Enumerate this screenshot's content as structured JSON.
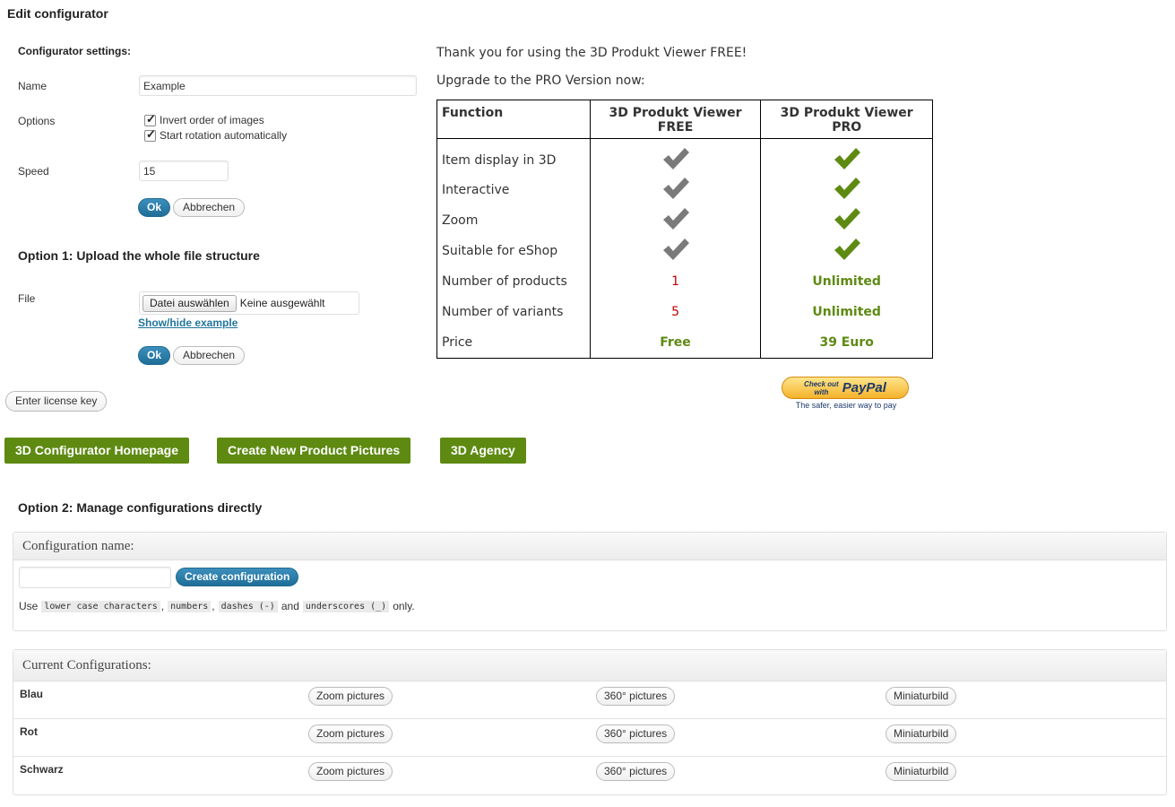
{
  "page_title": "Edit configurator",
  "settings": {
    "heading": "Configurator settings:",
    "name_label": "Name",
    "name_value": "Example",
    "options_label": "Options",
    "option_invert": "Invert order of images",
    "option_rotation": "Start rotation automatically",
    "speed_label": "Speed",
    "speed_value": "15",
    "ok_label": "Ok",
    "cancel_label": "Abbrechen"
  },
  "option1": {
    "heading": "Option 1: Upload the whole file structure",
    "file_label": "File",
    "choose_file_label": "Datei auswählen",
    "no_file_text": "Keine ausgewählt",
    "show_hide_link": "Show/hide example",
    "ok_label": "Ok",
    "cancel_label": "Abbrechen"
  },
  "license_button": "Enter license key",
  "promo": {
    "thank_you": "Thank you for using the 3D Produkt Viewer FREE!",
    "upgrade": "Upgrade to the PRO Version now:",
    "table": {
      "col_function": "Function",
      "col_free_line1": "3D Produkt Viewer",
      "col_free_line2": "FREE",
      "col_pro_line1": "3D Produkt Viewer",
      "col_pro_line2": "PRO",
      "rows": [
        {
          "label": "Item display in 3D",
          "free": "check",
          "pro": "check"
        },
        {
          "label": "Interactive",
          "free": "check",
          "pro": "check"
        },
        {
          "label": "Zoom",
          "free": "check",
          "pro": "check"
        },
        {
          "label": "Suitable for eShop",
          "free": "check",
          "pro": "check"
        },
        {
          "label": "Number of products",
          "free": "1",
          "pro": "Unlimited"
        },
        {
          "label": "Number of variants",
          "free": "5",
          "pro": "Unlimited"
        },
        {
          "label": "Price",
          "free": "Free",
          "pro": "39 Euro"
        }
      ]
    },
    "paypal": {
      "checkout_line1": "Check out",
      "checkout_line2": "with",
      "brand": "PayPal",
      "tagline": "The safer, easier way to pay"
    }
  },
  "links": {
    "homepage": "3D Configurator Homepage",
    "create_pictures": "Create New Product Pictures",
    "agency": "3D Agency"
  },
  "option2": {
    "heading": "Option 2: Manage configurations directly",
    "config_name_header": "Configuration name:",
    "config_name_value": "",
    "create_button": "Create configuration",
    "hint_use": "Use",
    "hint_lower": "lower case characters",
    "hint_comma1": ",",
    "hint_numbers": "numbers",
    "hint_comma2": ",",
    "hint_dashes": "dashes (-)",
    "hint_and": "and",
    "hint_underscores": "underscores (_)",
    "hint_only": "only.",
    "current_header": "Current Configurations:",
    "configs": [
      {
        "name": "Blau",
        "zoom": "Zoom pictures",
        "pics360": "360° pictures",
        "thumb": "Miniaturbild"
      },
      {
        "name": "Rot",
        "zoom": "Zoom pictures",
        "pics360": "360° pictures",
        "thumb": "Miniaturbild"
      },
      {
        "name": "Schwarz",
        "zoom": "Zoom pictures",
        "pics360": "360° pictures",
        "thumb": "Miniaturbild"
      }
    ]
  },
  "colors": {
    "accent_green": "#5e8a12",
    "check_grey": "#7a7a7a",
    "primary_blue": "#21759b",
    "red_value": "#c00000"
  }
}
